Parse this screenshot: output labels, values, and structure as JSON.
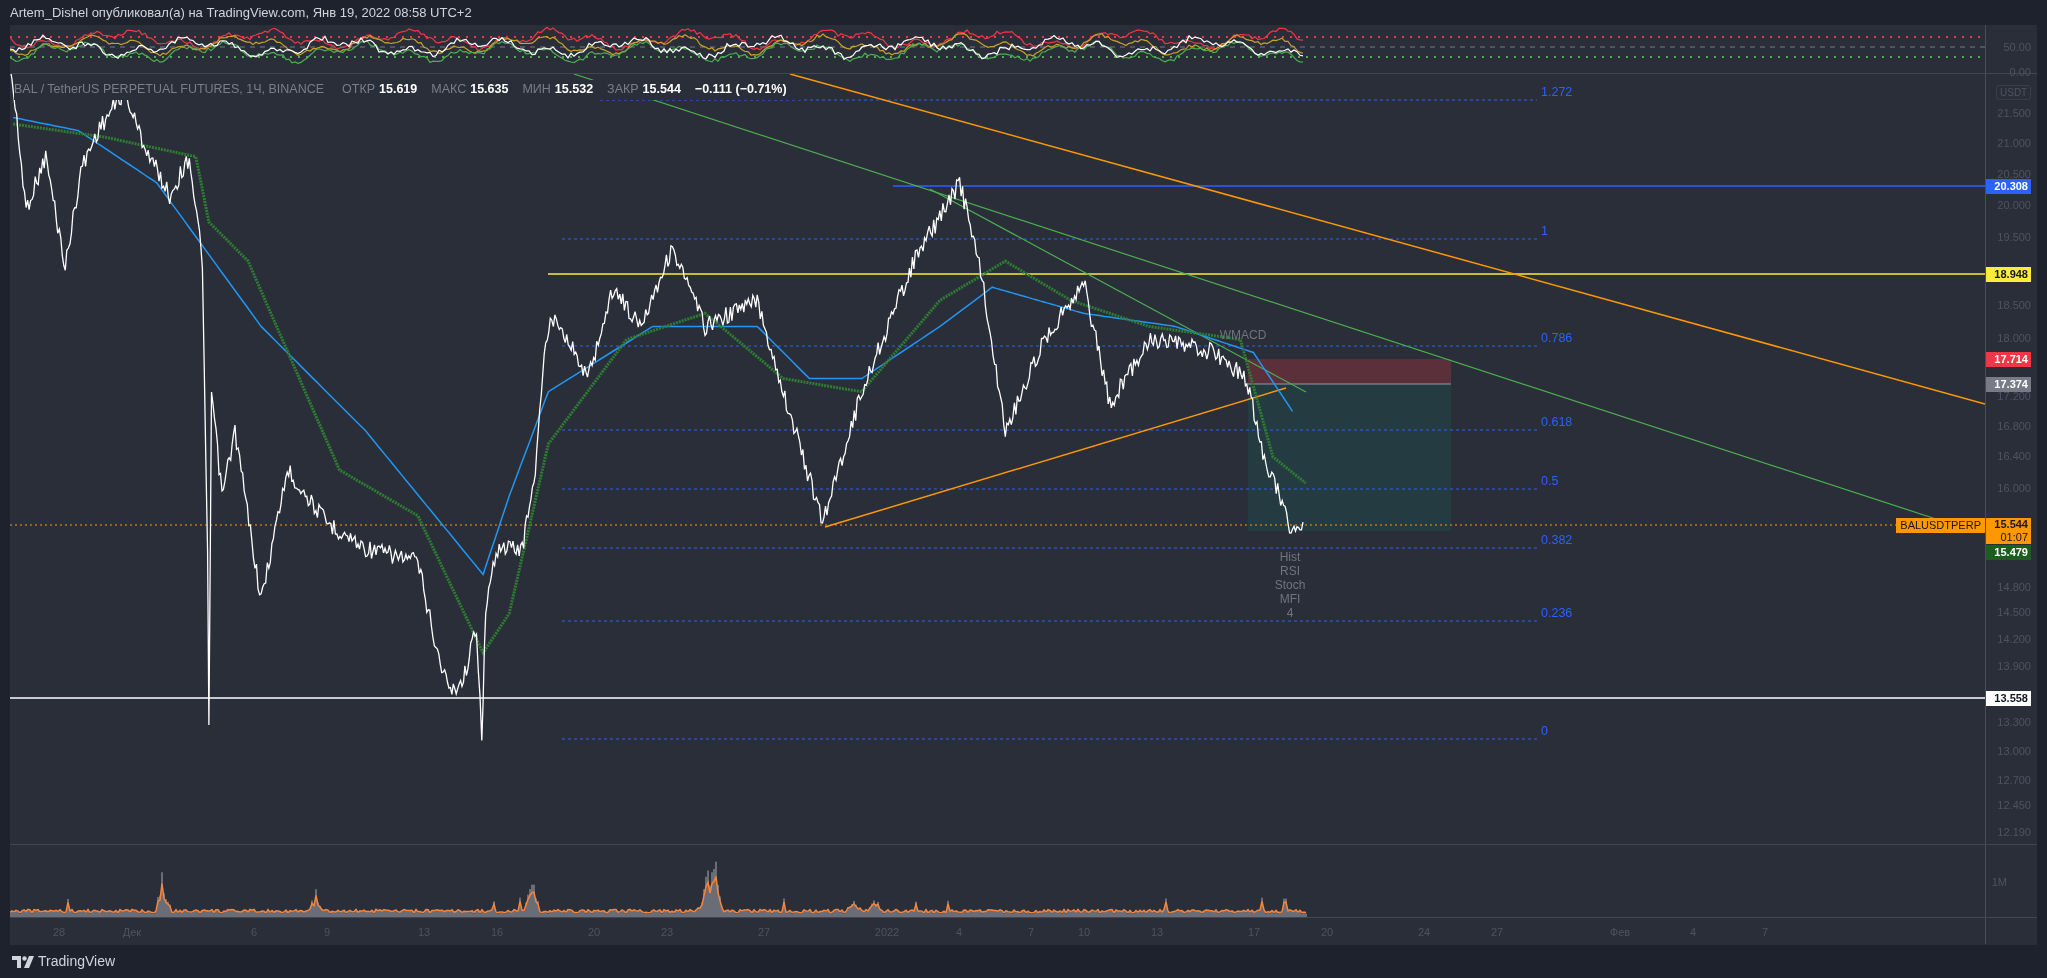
{
  "header": {
    "text": "Artem_Dishel опубликовал(а) на TradingView.com, Янв 19, 2022 08:58 UTC+2"
  },
  "rsi_pane": {
    "axis_labels": [
      "50.00",
      "0.00"
    ]
  },
  "legend": {
    "title": "BAL / TetherUS PERPETUAL FUTURES, 1Ч, BINANCE",
    "fields": [
      {
        "label": "ОТКР",
        "value": "15.619"
      },
      {
        "label": "МАКС",
        "value": "15.635"
      },
      {
        "label": "МИН",
        "value": "15.532"
      },
      {
        "label": "ЗАКР",
        "value": "15.544"
      }
    ],
    "change": "−0.111 (−0.71%)"
  },
  "fib_levels": [
    "1.272",
    "1",
    "0.786",
    "0.618",
    "0.5",
    "0.382",
    "0.236",
    "0"
  ],
  "indicator_labels": [
    "WMACD",
    "Hist",
    "RSI",
    "Stoch",
    "MFI",
    "4"
  ],
  "symbol_tag": "BALUSDTPERP",
  "price_axis": {
    "unit": "USDT",
    "labels": [
      "21.500",
      "21.000",
      "20.500",
      "20.000",
      "19.500",
      "18.500",
      "18.000",
      "17.200",
      "16.800",
      "16.400",
      "16.000",
      "14.800",
      "14.500",
      "14.200",
      "13.900",
      "13.300",
      "13.000",
      "12.700",
      "12.450",
      "12.190"
    ],
    "tags": [
      {
        "text": "20.308",
        "color": "#2962ff"
      },
      {
        "text": "18.948",
        "color": "#ffeb3b"
      },
      {
        "text": "17.714",
        "color": "#f23645"
      },
      {
        "text": "17.374",
        "color": "#787b86"
      },
      {
        "text": "15.544",
        "subtext": "01:07",
        "color": "#ff9800"
      },
      {
        "text": "15.479",
        "color": "#1b5e20"
      },
      {
        "text": "13.558",
        "color": "#ffffff"
      }
    ]
  },
  "volume_pane": {
    "axis_label": "1M"
  },
  "time_axis": {
    "labels": [
      "28",
      "Дек",
      "6",
      "9",
      "13",
      "16",
      "20",
      "23",
      "27",
      "2022",
      "4",
      "7",
      "10",
      "13",
      "17",
      "20",
      "24",
      "27",
      "Фев",
      "4",
      "7"
    ]
  },
  "footer": {
    "brand": "TradingView"
  }
}
